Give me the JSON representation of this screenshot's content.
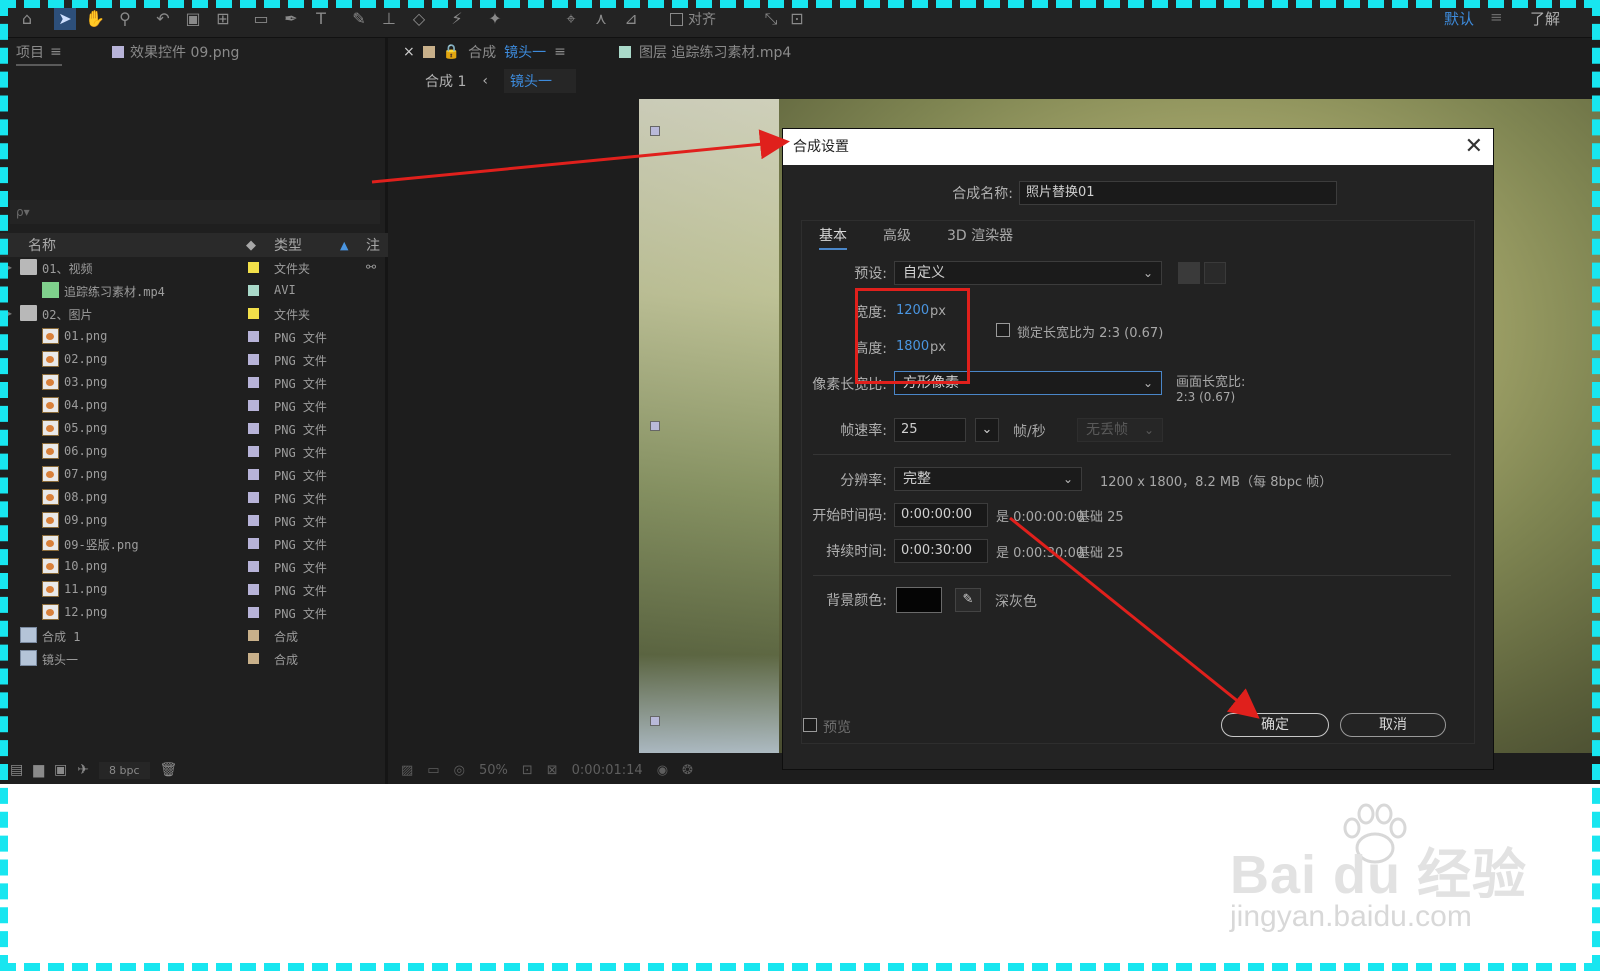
{
  "toolbar": {
    "snap_label": "对齐",
    "workspace": "默认",
    "learn": "了解",
    "menu_icon": "≡"
  },
  "project": {
    "tabs": [
      {
        "label": "项目"
      },
      {
        "label": "效果控件 09.png"
      }
    ],
    "menu_icon": "≡",
    "search_placeholder": "ρ▾",
    "col_name": "名称",
    "col_type": "类型",
    "col_note": "注",
    "items": [
      {
        "name": "01、视频",
        "type": "文件夹",
        "kind": "folder",
        "color": "#f2e04a",
        "indent": 0
      },
      {
        "name": "追踪练习素材.mp4",
        "type": "AVI",
        "kind": "avi",
        "color": "#a9d9c9",
        "indent": 1
      },
      {
        "name": "02、图片",
        "type": "文件夹",
        "kind": "folder",
        "color": "#f2e04a",
        "indent": 0
      },
      {
        "name": "01.png",
        "type": "PNG 文件",
        "kind": "png",
        "color": "#b7b3d8",
        "indent": 1
      },
      {
        "name": "02.png",
        "type": "PNG 文件",
        "kind": "png",
        "color": "#b7b3d8",
        "indent": 1
      },
      {
        "name": "03.png",
        "type": "PNG 文件",
        "kind": "png",
        "color": "#b7b3d8",
        "indent": 1
      },
      {
        "name": "04.png",
        "type": "PNG 文件",
        "kind": "png",
        "color": "#b7b3d8",
        "indent": 1
      },
      {
        "name": "05.png",
        "type": "PNG 文件",
        "kind": "png",
        "color": "#b7b3d8",
        "indent": 1
      },
      {
        "name": "06.png",
        "type": "PNG 文件",
        "kind": "png",
        "color": "#b7b3d8",
        "indent": 1
      },
      {
        "name": "07.png",
        "type": "PNG 文件",
        "kind": "png",
        "color": "#b7b3d8",
        "indent": 1
      },
      {
        "name": "08.png",
        "type": "PNG 文件",
        "kind": "png",
        "color": "#b7b3d8",
        "indent": 1
      },
      {
        "name": "09.png",
        "type": "PNG 文件",
        "kind": "png",
        "color": "#b7b3d8",
        "indent": 1
      },
      {
        "name": "09-竖版.png",
        "type": "PNG 文件",
        "kind": "png",
        "color": "#b7b3d8",
        "indent": 1
      },
      {
        "name": "10.png",
        "type": "PNG 文件",
        "kind": "png",
        "color": "#b7b3d8",
        "indent": 1
      },
      {
        "name": "11.png",
        "type": "PNG 文件",
        "kind": "png",
        "color": "#b7b3d8",
        "indent": 1
      },
      {
        "name": "12.png",
        "type": "PNG 文件",
        "kind": "png",
        "color": "#b7b3d8",
        "indent": 1
      },
      {
        "name": "合成 1",
        "type": "合成",
        "kind": "comp",
        "color": "#c8b08a",
        "indent": 0
      },
      {
        "name": "镜头一",
        "type": "合成",
        "kind": "comp",
        "color": "#c8b08a",
        "indent": 0
      }
    ],
    "bpc": "8 bpc"
  },
  "comp": {
    "tab_prefix": "合成",
    "tab_name": "镜头一",
    "layer_tab": "图层 追踪练习素材.mp4",
    "crumb_1": "合成 1",
    "crumb_sep": "‹",
    "crumb_2": "镜头一",
    "footer_zoom": "50%",
    "footer_time": "0:00:01:14"
  },
  "dialog": {
    "title": "合成设置",
    "close": "✕",
    "name_label": "合成名称:",
    "name_value": "照片替换01",
    "tabs": [
      "基本",
      "高级",
      "3D 渲染器"
    ],
    "preset_label": "预设:",
    "preset_value": "自定义",
    "width_label": "宽度:",
    "width_value": "1200",
    "height_label": "高度:",
    "height_value": "1800",
    "px": "px",
    "lock_label": "锁定长宽比为 2:3 (0.67)",
    "par_label": "像素长宽比:",
    "par_value": "方形像素",
    "frame_aspect_label": "画面长宽比:",
    "frame_aspect_value": "2:3 (0.67)",
    "fps_label": "帧速率:",
    "fps_value": "25",
    "fps_unit": "帧/秒",
    "drop_frame": "无丢帧",
    "res_label": "分辨率:",
    "res_value": "完整",
    "res_info": "1200 x 1800，8.2 MB（每 8bpc 帧）",
    "start_label": "开始时间码:",
    "start_value": "0:00:00:00",
    "start_info": "是 0:00:00:00",
    "start_base": "基础 25",
    "dur_label": "持续时间:",
    "dur_value": "0:00:30:00",
    "dur_info": "是 0:00:30:00",
    "dur_base": "基础 25",
    "bg_label": "背景颜色:",
    "bg_name": "深灰色",
    "preview_label": "预览",
    "ok": "确定",
    "cancel": "取消"
  },
  "watermark": {
    "logo": "Bai du 经验",
    "url": "jingyan.baidu.com"
  },
  "colors": {
    "frame": "#18e6f0",
    "annotation": "#e0201c",
    "accent": "#3d8bdc"
  }
}
